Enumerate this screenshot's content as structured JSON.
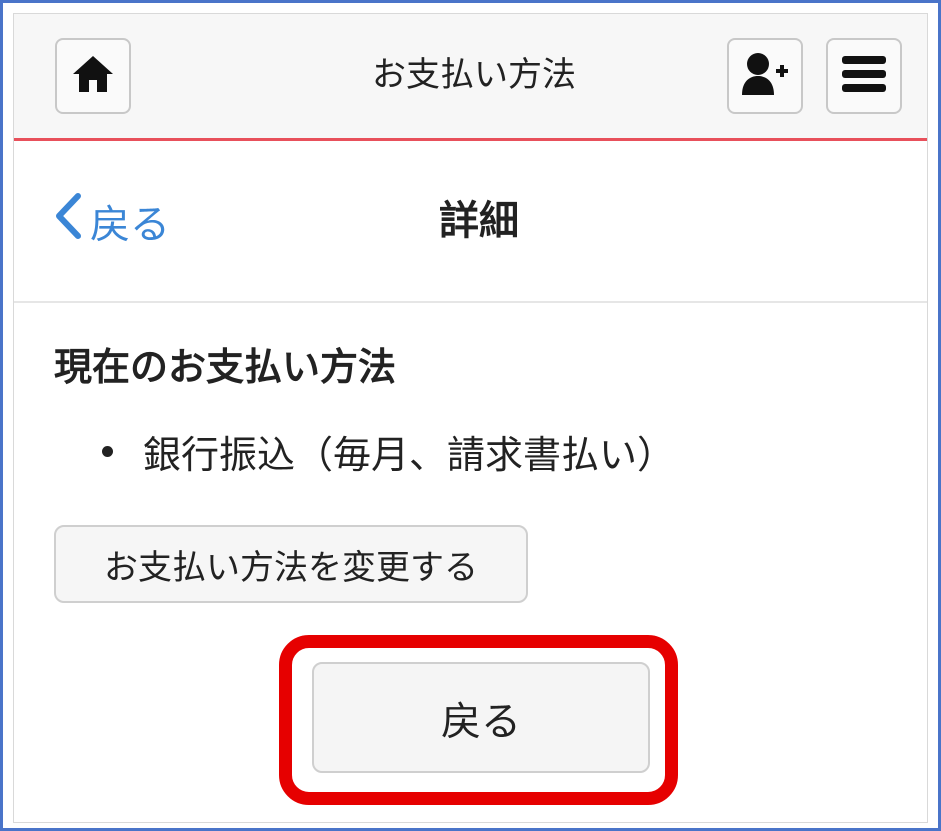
{
  "header": {
    "title": "お支払い方法",
    "home_icon": "home-icon",
    "add_user_icon": "add-user-icon",
    "menu_icon": "hamburger-menu-icon"
  },
  "subnav": {
    "back_label": "戻る",
    "title": "詳細"
  },
  "main": {
    "section_heading": "現在のお支払い方法",
    "methods": [
      "銀行振込（毎月、請求書払い）"
    ],
    "change_button_label": "お支払い方法を変更する",
    "back_button_label": "戻る"
  },
  "colors": {
    "header_border": "#e8505b",
    "link": "#3b86d6",
    "highlight": "#e60000",
    "frame": "#4a74c9"
  }
}
